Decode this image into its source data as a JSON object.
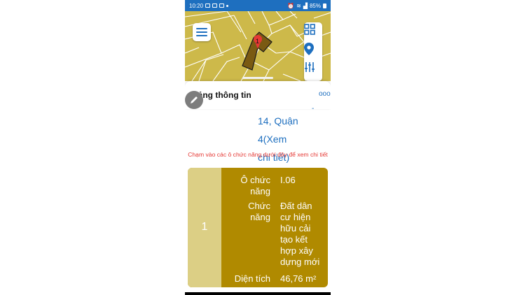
{
  "status_bar": {
    "time": "10:20",
    "battery": "85%",
    "icons": [
      "message-icon",
      "gallery-icon",
      "mail-icon",
      "dot-icon",
      "alarm-icon",
      "wifi-icon",
      "signal-icon",
      "battery-icon"
    ]
  },
  "map": {
    "parcel_label": "1",
    "colors": {
      "land": "#cdb94a",
      "lines": "#ffffff",
      "parcel": "#7a5a12",
      "pin": "#e53935"
    }
  },
  "toolbar": {
    "menu_icon": "hamburger-menu-icon",
    "layers_icon": "grid-layers-icon",
    "location_icon": "location-pin-icon",
    "filter_icon": "sliders-icon"
  },
  "panel": {
    "title": "Bảng thông tin",
    "more_icon": "more-dots-icon",
    "more_label": "ooo",
    "edit_icon": "pencil-icon",
    "peek_text": "-",
    "address_line1": "14, Quận 4(Xem",
    "address_line2": "chi tiết)",
    "hint": "Chạm vào các ô chức năng dưới đây để xem chi tiết"
  },
  "card": {
    "index": "1",
    "rows": [
      {
        "label_l1": "Ô chức",
        "label_l2": "năng",
        "value": "I.06"
      },
      {
        "label_l1": "Chức",
        "label_l2": "năng",
        "value_lines": [
          "Đất dân",
          "cư hiện",
          "hữu cải",
          "tạo kết",
          "hợp xây",
          "dựng mới"
        ]
      },
      {
        "label_l1": "Diện tích",
        "value": "46,76 m²"
      }
    ],
    "colors": {
      "left": "#dccf85",
      "body": "#b08a00",
      "text": "#ffffff"
    }
  },
  "accent_color": "#1e6fbf",
  "hint_color": "#e53935"
}
